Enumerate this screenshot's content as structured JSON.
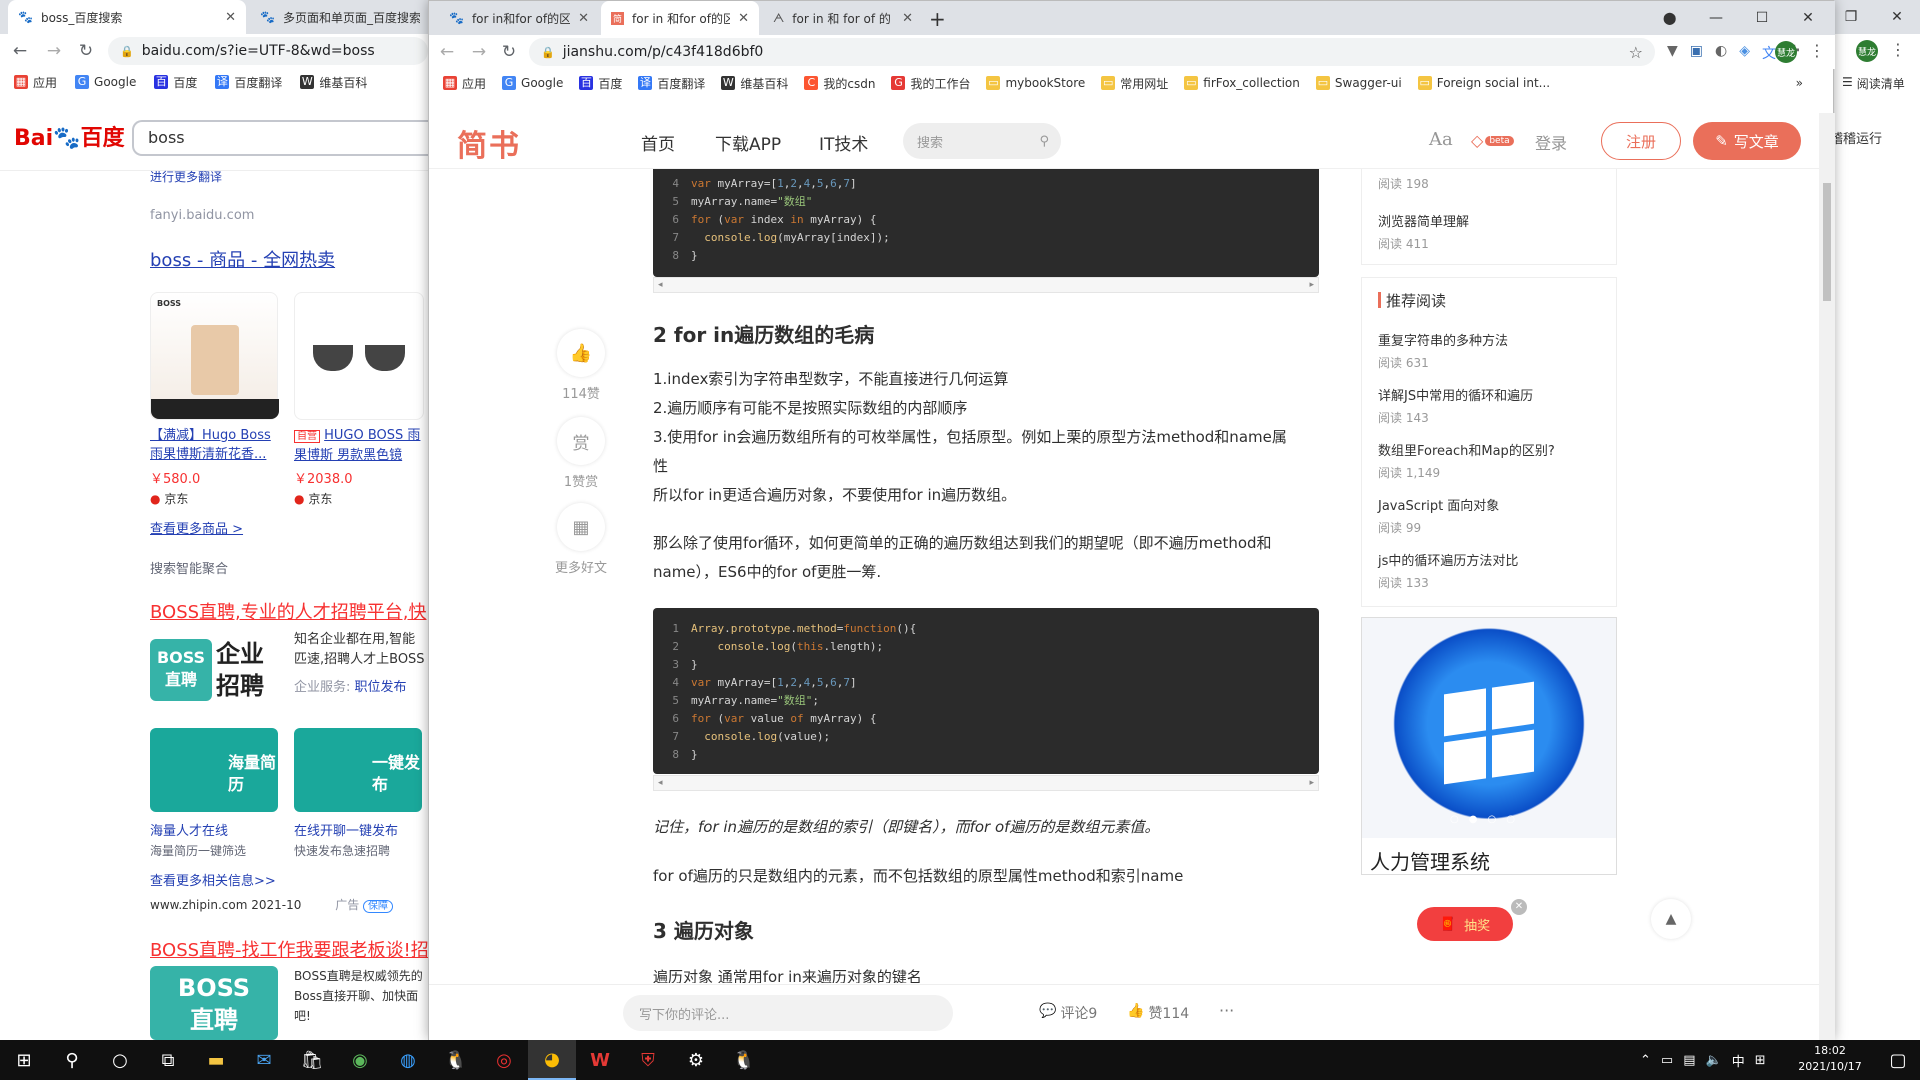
{
  "bg_browser": {
    "tabs": [
      {
        "label": "boss_百度搜索",
        "icon": "baidu-paw"
      },
      {
        "label": "多页面和单页面_百度搜索",
        "icon": "baidu-paw"
      }
    ],
    "url": "baidu.com/s?ie=UTF-8&wd=boss",
    "bookmarks": [
      "应用",
      "Google",
      "百度",
      "百度翻译",
      "维基百科"
    ],
    "right_bookmark": "阅读清单",
    "profile_initials": "慧龙",
    "side_text": "稽稽运行",
    "search_query": "boss",
    "logo_text": "百度",
    "more_trans": "进行更多翻译",
    "fanyi_source": "fanyi.baidu.com",
    "goods_title": "boss - 商品 - 全网热卖",
    "products": [
      {
        "brand": "BOSS",
        "name": "【满减】Hugo Boss 雨果博斯清新花香...",
        "price": "￥580.0",
        "store": "京东"
      },
      {
        "tag": "自营",
        "name": "HUGO BOSS 雨果博斯 男款黑色镜",
        "price": "￥2038.0",
        "store": "京东"
      }
    ],
    "more_goods": "查看更多商品 >",
    "agg_label": "搜索智能聚合",
    "result1_title": "BOSS直聘,专业的人才招聘平台,快",
    "result1_logo": [
      "BOSS",
      "直聘",
      "企业",
      "招聘"
    ],
    "result1_desc": "知名企业都在用,智能匹速,招聘人才上BOSS直",
    "result1_service_label": "企业服务:",
    "result1_service_link": "职位发布",
    "cards": [
      {
        "text": "海量简历",
        "link": "海量人才在线",
        "desc": "海量简历一键筛选"
      },
      {
        "text": "一键发布",
        "link": "在线开聊一键发布",
        "desc": "快速发布急速招聘"
      }
    ],
    "more_info": "查看更多相关信息>>",
    "zhipin": "www.zhipin.com 2021-10",
    "ad_label": "广告",
    "guarantee": "保障",
    "result2_title": "BOSS直聘-找工作我要跟老板谈!招",
    "result2_logo": [
      "BOSS",
      "直聘"
    ],
    "result2_desc": [
      "BOSS直聘是权威领先的",
      "Boss直接开聊、加快面",
      "吧!"
    ]
  },
  "fg_browser": {
    "tabs": [
      {
        "label": "for in和for of的区",
        "icon": "baidu-paw"
      },
      {
        "label": "for in 和for of的区",
        "icon": "jianshu-icon"
      },
      {
        "label": "for in 和 for of 的",
        "icon": "generic-icon"
      }
    ],
    "url": "jianshu.com/p/c43f418d6bf0",
    "bookmarks": [
      "应用",
      "Google",
      "百度",
      "百度翻译",
      "维基百科",
      "我的csdn",
      "我的工作台",
      "mybookStore",
      "常用网址",
      "firFox_collection",
      "Swagger-ui",
      "Foreign social int..."
    ],
    "profile_initials": "慧龙"
  },
  "jianshu": {
    "logo": "简书",
    "nav": [
      "首页",
      "下载APP",
      "IT技术"
    ],
    "search_placeholder": "搜索",
    "font_icon": "Aa",
    "beta": "beta",
    "login": "登录",
    "register": "注册",
    "write": "写文章",
    "like_count": "114赞",
    "reward_icon": "赏",
    "reward_count": "1赞赏",
    "more_friends": "更多好文",
    "code1": [
      {
        "n": "4",
        "code": "var myArray=[1,2,4,5,6,7]"
      },
      {
        "n": "5",
        "code": "myArray.name=\"数组\""
      },
      {
        "n": "6",
        "code": "for (var index in myArray) {"
      },
      {
        "n": "7",
        "code": "  console.log(myArray[index]);"
      },
      {
        "n": "8",
        "code": "}"
      }
    ],
    "h2_a": "2 for in遍历数组的毛病",
    "para_a": [
      "1.index索引为字符串型数字，不能直接进行几何运算",
      "2.遍历顺序有可能不是按照实际数组的内部顺序",
      "3.使用for in会遍历数组所有的可枚举属性，包括原型。例如上栗的原型方法method和name属",
      "性",
      "所以for in更适合遍历对象，不要使用for in遍历数组。"
    ],
    "para_b": [
      "那么除了使用for循环，如何更简单的正确的遍历数组达到我们的期望呢（即不遍历method和",
      "name），ES6中的for of更胜一筹."
    ],
    "code2": [
      {
        "n": "1",
        "code": "Array.prototype.method=function(){"
      },
      {
        "n": "2",
        "code": "    console.log(this.length);"
      },
      {
        "n": "3",
        "code": "}"
      },
      {
        "n": "4",
        "code": "var myArray=[1,2,4,5,6,7]"
      },
      {
        "n": "5",
        "code": "myArray.name=\"数组\";"
      },
      {
        "n": "6",
        "code": "for (var value of myArray) {"
      },
      {
        "n": "7",
        "code": "  console.log(value);"
      },
      {
        "n": "8",
        "code": "}"
      }
    ],
    "note": "记住，for in遍历的是数组的索引（即键名），而for of遍历的是数组元素值。",
    "para_c": "for of遍历的只是数组内的元素，而不包括数组的原型属性method和索引name",
    "h2_b": "3 遍历对象",
    "para_d": "遍历对象 通常用for in来遍历对象的键名",
    "side_top": [
      {
        "read": "阅读 198"
      },
      {
        "title": "浏览器简单理解",
        "read": "阅读 411"
      }
    ],
    "rec_heading": "推荐阅读",
    "recommended": [
      {
        "title": "重复字符串的多种方法",
        "read": "阅读 631"
      },
      {
        "title": "详解JS中常用的循环和遍历",
        "read": "阅读 143"
      },
      {
        "title": "数组里Foreach和Map的区别?",
        "read": "阅读 1,149"
      },
      {
        "title": "JavaScript 面向对象",
        "read": "阅读 99"
      },
      {
        "title": "js中的循环遍历方法对比",
        "read": "阅读 133"
      }
    ],
    "ad_caption": "人力管理系统",
    "lottery": "抽奖",
    "comment_placeholder": "写下你的评论...",
    "comment_count": "评论9",
    "like_bottom": "赞114",
    "more": "···"
  },
  "taskbar": {
    "time": "18:02",
    "date": "2021/10/17",
    "ime": "中"
  }
}
